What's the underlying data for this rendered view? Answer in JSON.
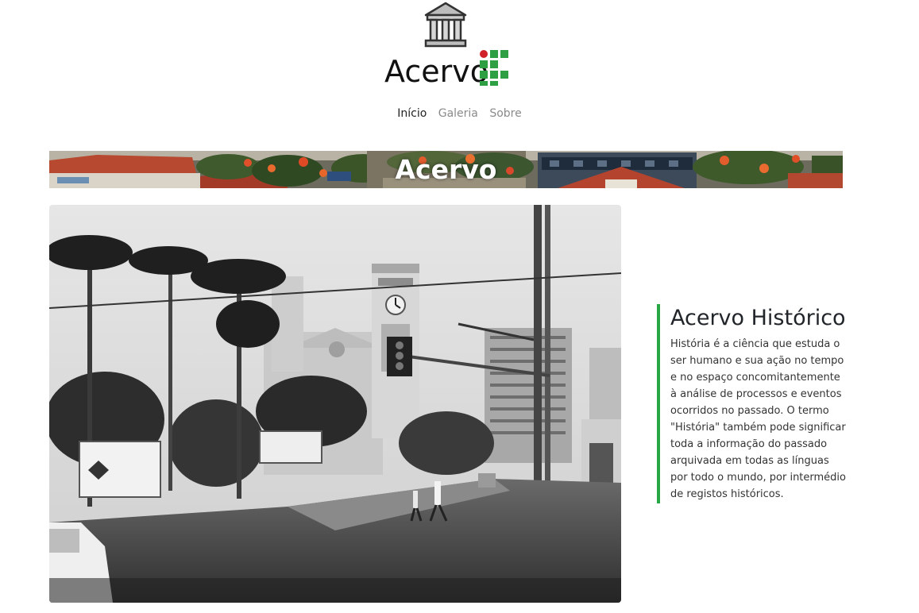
{
  "header": {
    "brand_text": "Acervo",
    "museum_icon": "museum-building-icon",
    "logo_icon": "if-logo-icon",
    "brand_colors": {
      "green": "#2ea043",
      "red": "#d0202a"
    }
  },
  "nav": {
    "items": [
      {
        "label": "Início",
        "active": true
      },
      {
        "label": "Galeria",
        "active": false
      },
      {
        "label": "Sobre",
        "active": false
      }
    ]
  },
  "banner": {
    "title": "Acervo"
  },
  "main": {
    "photo_icon": "historic-city-photo",
    "info": {
      "title": "Acervo Histórico",
      "body": "História é a ciência que estuda o ser humano e sua ação no tempo e no espaço concomitantemente à análise de processos e eventos ocorridos no passado. O termo \"História\" também pode significar toda a informação do passado arquivada em todas as línguas por todo o mundo, por intermédio de registos históricos.",
      "accent_color": "#28a745"
    }
  }
}
